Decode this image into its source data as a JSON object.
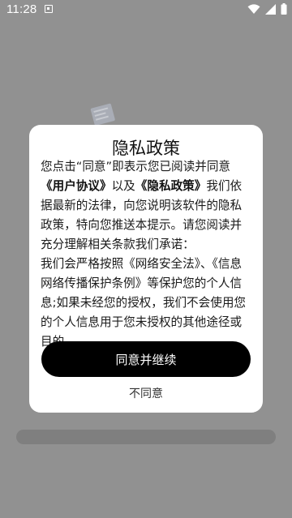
{
  "status_bar": {
    "time": "11:28",
    "app_icon": "notification-app-icon",
    "wifi_icon": "wifi-icon",
    "signal_icon": "cell-signal-icon",
    "battery_icon": "battery-icon"
  },
  "dialog": {
    "title": "隐私政策",
    "body": {
      "p1_before_link1": "您点击“同意”即表示您已阅读并同意",
      "link_user_agreement": "《用户协议》",
      "p1_between_links": "以及",
      "link_privacy_policy": "《隐私政策》",
      "p1_after_links": "我们依据最新的法律，向您说明该软件的隐私政策，特向您推送本提示。请您阅读并充分理解相关条款我们承诺：",
      "p2": "我们会严格按照《网络安全法》、《信息网络传播保护条例》等保护您的个人信息;如果未经您的授权，我们不会使用您的个人信息用于您未授权的其他途径或目的。"
    },
    "agree_label": "同意并继续",
    "disagree_label": "不同意"
  },
  "colors": {
    "overlay": "#919191",
    "dialog_background": "#ffffff",
    "primary_button": "#000000",
    "primary_button_text": "#ffffff"
  }
}
